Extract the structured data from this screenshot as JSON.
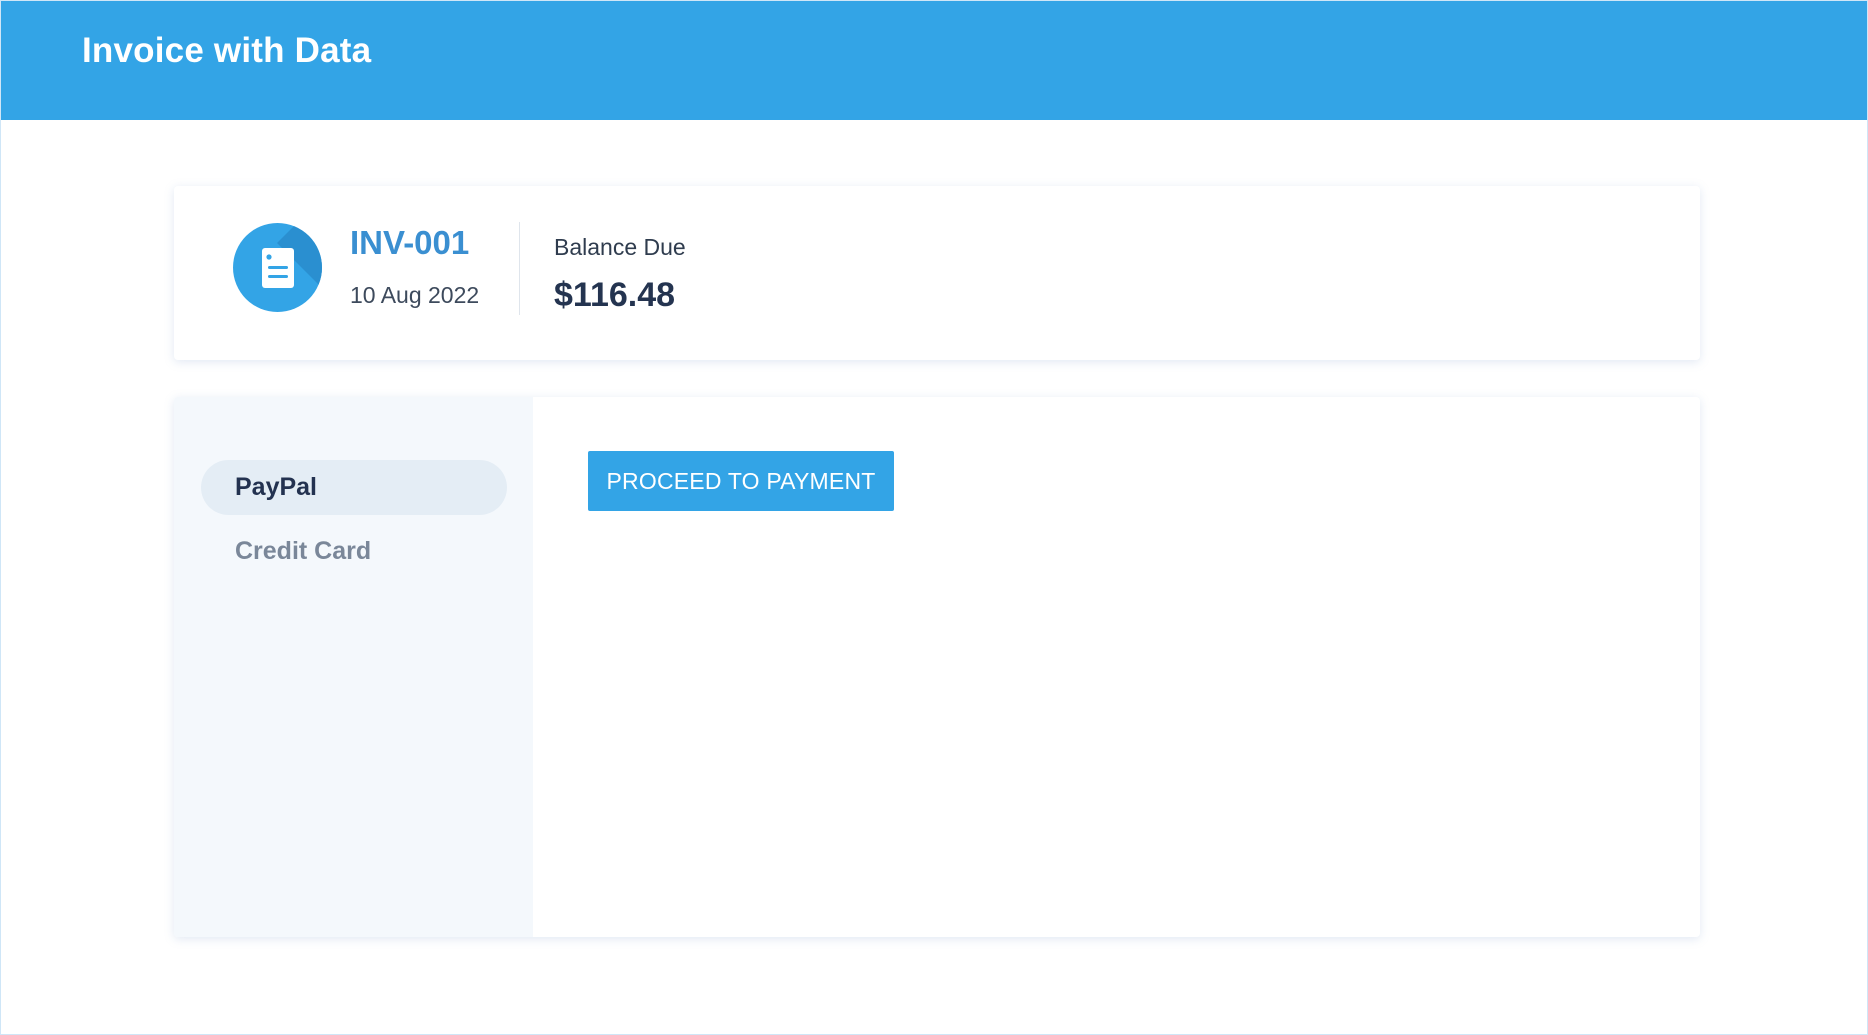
{
  "header": {
    "title": "Invoice with Data"
  },
  "invoice": {
    "icon": "invoice-document-icon",
    "number": "INV-001",
    "date": "10 Aug 2022",
    "balance_label": "Balance Due",
    "balance_amount": "$116.48"
  },
  "payment": {
    "methods": [
      {
        "label": "PayPal",
        "selected": true
      },
      {
        "label": "Credit Card",
        "selected": false
      }
    ],
    "proceed_label": "PROCEED TO PAYMENT"
  },
  "colors": {
    "primary": "#33a4e6",
    "invoice_id": "#3a8fd1",
    "text_dark": "#243450",
    "text_muted": "#7a8799",
    "sidebar_bg": "#f4f8fc",
    "active_pill": "#e4edf5"
  }
}
